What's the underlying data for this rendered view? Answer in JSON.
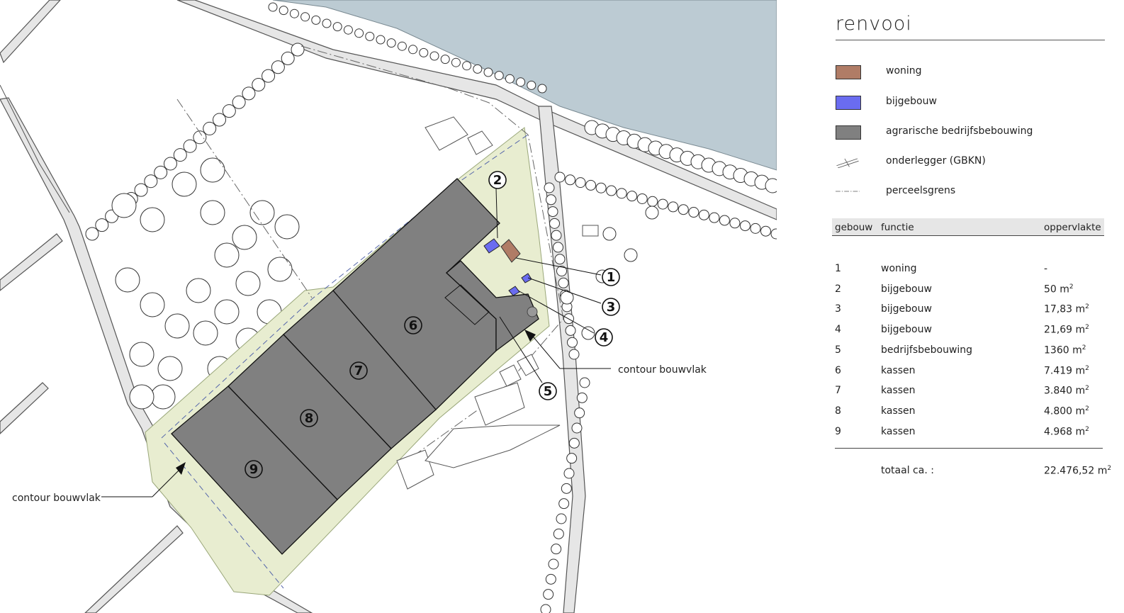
{
  "legend": {
    "title": "renvooi",
    "items": [
      {
        "label": "woning",
        "color": "#b07c66"
      },
      {
        "label": "bijgebouw",
        "color": "#6a6cf0"
      },
      {
        "label": "agrarische bedrijfsbebouwing",
        "color": "#808080"
      },
      {
        "label": "onderlegger (GBKN)",
        "symbol": "hatch-line"
      },
      {
        "label": "perceelsgrens",
        "symbol": "dash-dot-line"
      }
    ]
  },
  "table": {
    "headers": [
      "gebouw",
      "functie",
      "oppervlakte"
    ],
    "rows": [
      {
        "nr": "1",
        "functie": "woning",
        "opp": "-",
        "unit": ""
      },
      {
        "nr": "2",
        "functie": "bijgebouw",
        "opp": "50 m",
        "unit": "2"
      },
      {
        "nr": "3",
        "functie": "bijgebouw",
        "opp": "17,83 m",
        "unit": "2"
      },
      {
        "nr": "4",
        "functie": "bijgebouw",
        "opp": "21,69 m",
        "unit": "2"
      },
      {
        "nr": "5",
        "functie": "bedrijfsbebouwing",
        "opp": "1360 m",
        "unit": "2"
      },
      {
        "nr": "6",
        "functie": "kassen",
        "opp": "7.419 m",
        "unit": "2"
      },
      {
        "nr": "7",
        "functie": "kassen",
        "opp": "3.840 m",
        "unit": "2"
      },
      {
        "nr": "8",
        "functie": "kassen",
        "opp": "4.800 m",
        "unit": "2"
      },
      {
        "nr": "9",
        "functie": "kassen",
        "opp": "4.968 m",
        "unit": "2"
      }
    ],
    "total_label": "totaal ca. :",
    "total_value": "22.476,52 m",
    "total_unit": "2"
  },
  "map": {
    "callouts": [
      "contour bouwvlak",
      "contour bouwvlak"
    ],
    "building_numbers": [
      "1",
      "2",
      "3",
      "4",
      "5",
      "6",
      "7",
      "8",
      "9"
    ],
    "colors": {
      "water": "#bccbd3",
      "buildzone": "#e8edd0",
      "greenhouse": "#808080",
      "road": "#e4e4e4"
    }
  }
}
